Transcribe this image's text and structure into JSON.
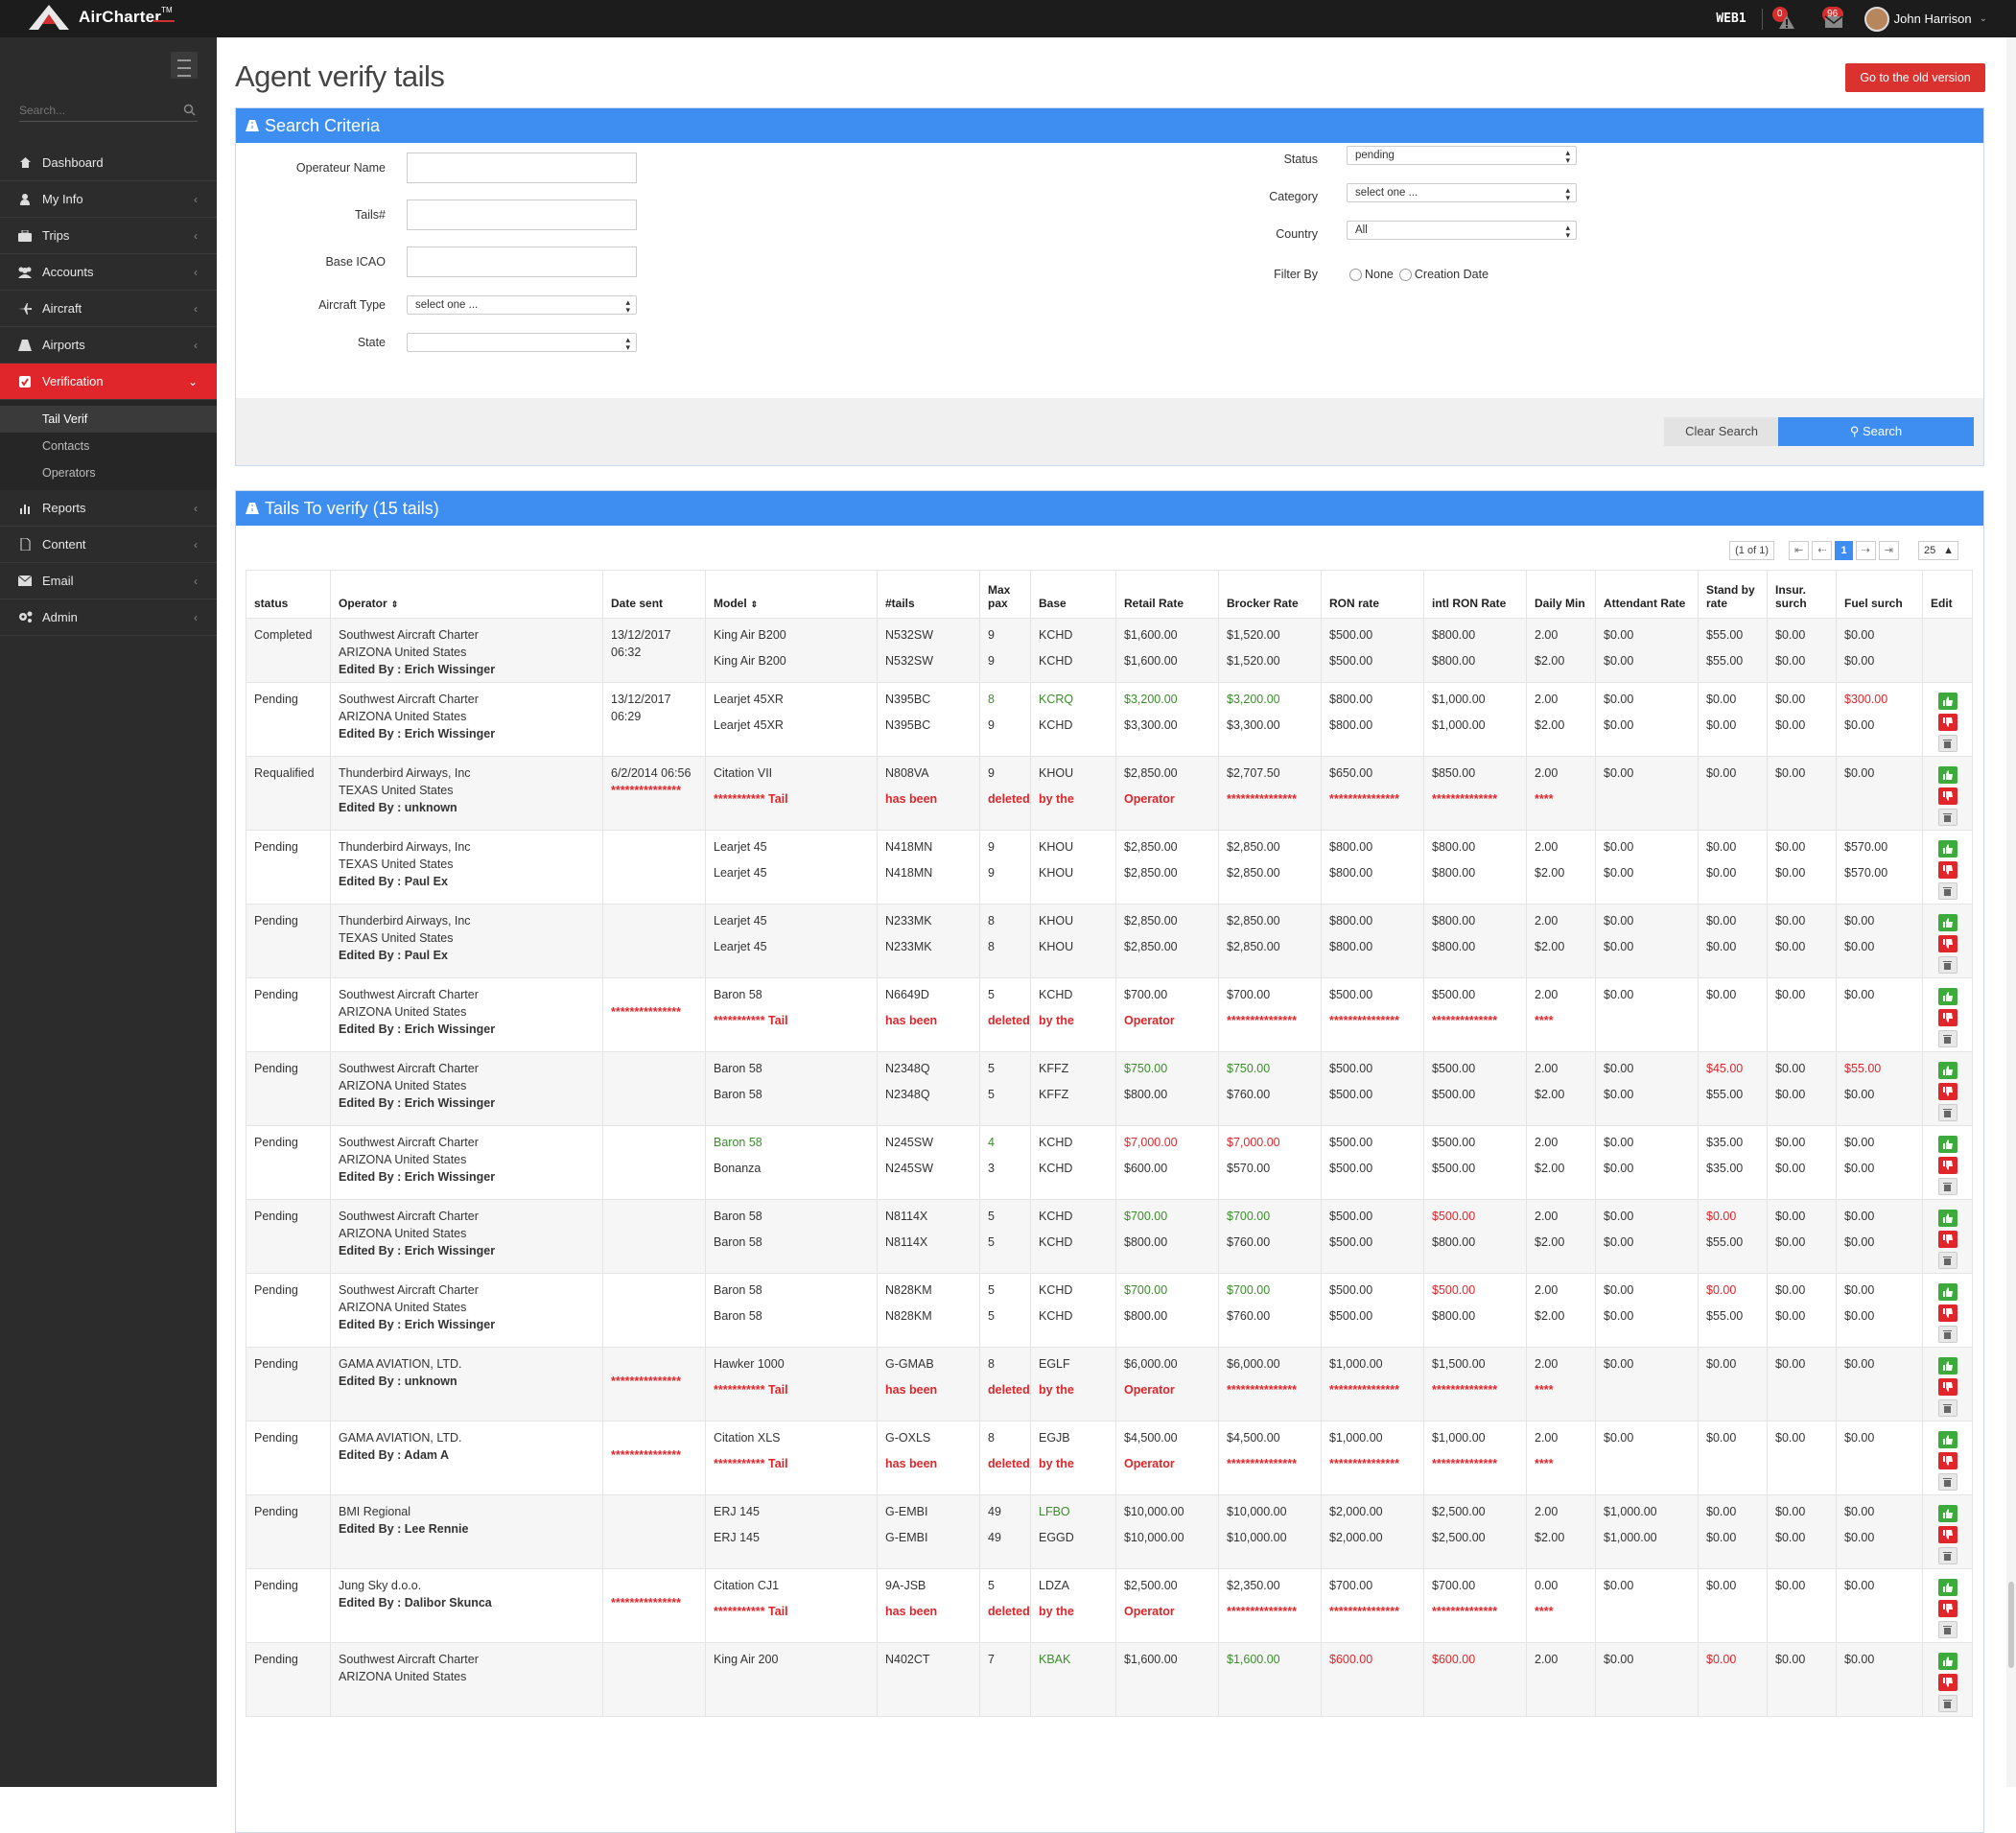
{
  "topbar": {
    "logo_text": "AirCharter",
    "logo_tm": "TM",
    "server": "WEB1",
    "alerts_count": "0",
    "messages_count": "96",
    "user_name": "John Harrison"
  },
  "sidebar": {
    "search_placeholder": "Search...",
    "items": [
      {
        "label": "Dashboard",
        "icon": "home-icon"
      },
      {
        "label": "My Info",
        "icon": "user-icon"
      },
      {
        "label": "Trips",
        "icon": "suitcase-icon"
      },
      {
        "label": "Accounts",
        "icon": "users-icon"
      },
      {
        "label": "Aircraft",
        "icon": "plane-icon"
      },
      {
        "label": "Airports",
        "icon": "road-icon"
      },
      {
        "label": "Verification",
        "icon": "check-square-icon"
      },
      {
        "label": "Reports",
        "icon": "bar-chart-icon"
      },
      {
        "label": "Content",
        "icon": "file-icon"
      },
      {
        "label": "Email",
        "icon": "envelope-icon"
      },
      {
        "label": "Admin",
        "icon": "cogs-icon"
      }
    ],
    "subitems": [
      "Tail Verif",
      "Contacts",
      "Operators"
    ]
  },
  "page": {
    "title": "Agent verify tails",
    "old_version_button": "Go to the old version"
  },
  "criteria": {
    "header": "Search Criteria",
    "operator_label": "Operateur Name",
    "tails_label": "Tails#",
    "base_label": "Base ICAO",
    "aircraft_type_label": "Aircraft Type",
    "aircraft_type_value": "select one ...",
    "state_label": "State",
    "state_value": "",
    "status_label": "Status",
    "status_value": "pending",
    "category_label": "Category",
    "category_value": "select one ...",
    "country_label": "Country",
    "country_value": "All",
    "filter_label": "Filter By",
    "filter_none": "None",
    "filter_creation": "Creation Date",
    "clear_button": "Clear Search",
    "search_button": "Search"
  },
  "tails": {
    "header": "Tails To verify (15 tails)",
    "pager_info": "(1 of 1)",
    "pager_first": "⇤",
    "pager_prev": "⇠",
    "pager_page": "1",
    "pager_next": "⇢",
    "pager_last": "⇥",
    "page_size": "25",
    "columns": [
      "status",
      "Operator",
      "Date sent",
      "Model",
      "#tails",
      "Max pax",
      "Base",
      "Retail Rate",
      "Brocker Rate",
      "RON rate",
      "intl RON Rate",
      "Daily Min",
      "Attendant Rate",
      "Stand by rate",
      "Insur. surch",
      "Fuel surch",
      "Edit"
    ],
    "deleted_tokens": [
      "***************",
      "*********** Tail",
      "has been",
      "deleted",
      "by the",
      "Operator",
      "***************",
      "***************",
      "**************",
      "****"
    ],
    "rows": [
      {
        "status": "Completed",
        "op": [
          "Southwest Aircraft Charter",
          "ARIZONA United States",
          "Edited By : Erich Wissinger"
        ],
        "date": "13/12/2017 06:32",
        "a": [
          "King Air B200",
          "N532SW",
          "9",
          "KCHD",
          "$1,600.00",
          "$1,520.00",
          "$500.00",
          "$800.00",
          "2.00",
          "$0.00",
          "$55.00",
          "$0.00",
          "$0.00"
        ],
        "b": [
          "King Air B200",
          "N532SW",
          "9",
          "KCHD",
          "$1,600.00",
          "$1,520.00",
          "$500.00",
          "$800.00",
          "$2.00",
          "$0.00",
          "$55.00",
          "$0.00",
          "$0.00"
        ],
        "edit": false
      },
      {
        "status": "Pending",
        "op": [
          "Southwest Aircraft Charter",
          "ARIZONA United States",
          "Edited By : Erich Wissinger"
        ],
        "date": "13/12/2017 06:29",
        "a": [
          "Learjet 45XR",
          "N395BC",
          "8",
          "KCRQ",
          "$3,200.00",
          "$3,200.00",
          "$800.00",
          "$1,000.00",
          "2.00",
          "$0.00",
          "$0.00",
          "$0.00",
          "$300.00"
        ],
        "b": [
          "Learjet 45XR",
          "N395BC",
          "9",
          "KCHD",
          "$3,300.00",
          "$3,300.00",
          "$800.00",
          "$1,000.00",
          "$2.00",
          "$0.00",
          "$0.00",
          "$0.00",
          "$0.00"
        ],
        "edit": true
      },
      {
        "status": "Requalified",
        "op": [
          "Thunderbird Airways, Inc",
          "TEXAS United States",
          "Edited By : unknown"
        ],
        "date": "6/2/2014 06:56",
        "a": [
          "Citation VII",
          "N808VA",
          "9",
          "KHOU",
          "$2,850.00",
          "$2,707.50",
          "$650.00",
          "$850.00",
          "2.00",
          "$0.00",
          "$0.00",
          "$0.00",
          "$0.00"
        ],
        "b": null,
        "edit": true
      },
      {
        "status": "Pending",
        "op": [
          "Thunderbird Airways, Inc",
          "TEXAS United States",
          "Edited By : Paul Ex"
        ],
        "date": "",
        "a": [
          "Learjet 45",
          "N418MN",
          "9",
          "KHOU",
          "$2,850.00",
          "$2,850.00",
          "$800.00",
          "$800.00",
          "2.00",
          "$0.00",
          "$0.00",
          "$0.00",
          "$570.00"
        ],
        "b": [
          "Learjet 45",
          "N418MN",
          "9",
          "KHOU",
          "$2,850.00",
          "$2,850.00",
          "$800.00",
          "$800.00",
          "$2.00",
          "$0.00",
          "$0.00",
          "$0.00",
          "$570.00"
        ],
        "edit": true
      },
      {
        "status": "Pending",
        "op": [
          "Thunderbird Airways, Inc",
          "TEXAS United States",
          "Edited By : Paul Ex"
        ],
        "date": "",
        "a": [
          "Learjet 45",
          "N233MK",
          "8",
          "KHOU",
          "$2,850.00",
          "$2,850.00",
          "$800.00",
          "$800.00",
          "2.00",
          "$0.00",
          "$0.00",
          "$0.00",
          "$0.00"
        ],
        "b": [
          "Learjet 45",
          "N233MK",
          "8",
          "KHOU",
          "$2,850.00",
          "$2,850.00",
          "$800.00",
          "$800.00",
          "$2.00",
          "$0.00",
          "$0.00",
          "$0.00",
          "$0.00"
        ],
        "edit": true
      },
      {
        "status": "Pending",
        "op": [
          "Southwest Aircraft Charter",
          "ARIZONA United States",
          "Edited By : Erich Wissinger"
        ],
        "date": "",
        "a": [
          "Baron 58",
          "N6649D",
          "5",
          "KCHD",
          "$700.00",
          "$700.00",
          "$500.00",
          "$500.00",
          "2.00",
          "$0.00",
          "$0.00",
          "$0.00",
          "$0.00"
        ],
        "b": null,
        "edit": true
      },
      {
        "status": "Pending",
        "op": [
          "Southwest Aircraft Charter",
          "ARIZONA United States",
          "Edited By : Erich Wissinger"
        ],
        "date": "",
        "a": [
          "Baron 58",
          "N2348Q",
          "5",
          "KFFZ",
          "$750.00",
          "$750.00",
          "$500.00",
          "$500.00",
          "2.00",
          "$0.00",
          "$45.00",
          "$0.00",
          "$55.00"
        ],
        "b": [
          "Baron 58",
          "N2348Q",
          "5",
          "KFFZ",
          "$800.00",
          "$760.00",
          "$500.00",
          "$500.00",
          "$2.00",
          "$0.00",
          "$55.00",
          "$0.00",
          "$0.00"
        ],
        "edit": true
      },
      {
        "status": "Pending",
        "op": [
          "Southwest Aircraft Charter",
          "ARIZONA United States",
          "Edited By : Erich Wissinger"
        ],
        "date": "",
        "a": [
          "Baron 58",
          "N245SW",
          "4",
          "KCHD",
          "$7,000.00",
          "$7,000.00",
          "$500.00",
          "$500.00",
          "2.00",
          "$0.00",
          "$35.00",
          "$0.00",
          "$0.00"
        ],
        "b": [
          "Bonanza",
          "N245SW",
          "3",
          "KCHD",
          "$600.00",
          "$570.00",
          "$500.00",
          "$500.00",
          "$2.00",
          "$0.00",
          "$35.00",
          "$0.00",
          "$0.00"
        ],
        "edit": true
      },
      {
        "status": "Pending",
        "op": [
          "Southwest Aircraft Charter",
          "ARIZONA United States",
          "Edited By : Erich Wissinger"
        ],
        "date": "",
        "a": [
          "Baron 58",
          "N8114X",
          "5",
          "KCHD",
          "$700.00",
          "$700.00",
          "$500.00",
          "$500.00",
          "2.00",
          "$0.00",
          "$0.00",
          "$0.00",
          "$0.00"
        ],
        "b": [
          "Baron 58",
          "N8114X",
          "5",
          "KCHD",
          "$800.00",
          "$760.00",
          "$500.00",
          "$800.00",
          "$2.00",
          "$0.00",
          "$55.00",
          "$0.00",
          "$0.00"
        ],
        "edit": true
      },
      {
        "status": "Pending",
        "op": [
          "Southwest Aircraft Charter",
          "ARIZONA United States",
          "Edited By : Erich Wissinger"
        ],
        "date": "",
        "a": [
          "Baron 58",
          "N828KM",
          "5",
          "KCHD",
          "$700.00",
          "$700.00",
          "$500.00",
          "$500.00",
          "2.00",
          "$0.00",
          "$0.00",
          "$0.00",
          "$0.00"
        ],
        "b": [
          "Baron 58",
          "N828KM",
          "5",
          "KCHD",
          "$800.00",
          "$760.00",
          "$500.00",
          "$800.00",
          "$2.00",
          "$0.00",
          "$55.00",
          "$0.00",
          "$0.00"
        ],
        "edit": true
      },
      {
        "status": "Pending",
        "op": [
          "GAMA AVIATION, LTD.",
          "Edited By : unknown"
        ],
        "date": "",
        "a": [
          "Hawker 1000",
          "G-GMAB",
          "8",
          "EGLF",
          "$6,000.00",
          "$6,000.00",
          "$1,000.00",
          "$1,500.00",
          "2.00",
          "$0.00",
          "$0.00",
          "$0.00",
          "$0.00"
        ],
        "b": null,
        "edit": true
      },
      {
        "status": "Pending",
        "op": [
          "GAMA AVIATION, LTD.",
          "Edited By : Adam A"
        ],
        "date": "",
        "a": [
          "Citation XLS",
          "G-OXLS",
          "8",
          "EGJB",
          "$4,500.00",
          "$4,500.00",
          "$1,000.00",
          "$1,000.00",
          "2.00",
          "$0.00",
          "$0.00",
          "$0.00",
          "$0.00"
        ],
        "b": null,
        "edit": true
      },
      {
        "status": "Pending",
        "op": [
          "BMI Regional",
          "Edited By : Lee Rennie"
        ],
        "date": "",
        "a": [
          "ERJ 145",
          "G-EMBI",
          "49",
          "LFBO",
          "$10,000.00",
          "$10,000.00",
          "$2,000.00",
          "$2,500.00",
          "2.00",
          "$1,000.00",
          "$0.00",
          "$0.00",
          "$0.00"
        ],
        "b": [
          "ERJ 145",
          "G-EMBI",
          "49",
          "EGGD",
          "$10,000.00",
          "$10,000.00",
          "$2,000.00",
          "$2,500.00",
          "$2.00",
          "$1,000.00",
          "$0.00",
          "$0.00",
          "$0.00"
        ],
        "edit": true
      },
      {
        "status": "Pending",
        "op": [
          "Jung Sky d.o.o.",
          "Edited By : Dalibor Skunca"
        ],
        "date": "",
        "a": [
          "Citation CJ1",
          "9A-JSB",
          "5",
          "LDZA",
          "$2,500.00",
          "$2,350.00",
          "$700.00",
          "$700.00",
          "0.00",
          "$0.00",
          "$0.00",
          "$0.00",
          "$0.00"
        ],
        "b": null,
        "edit": true
      },
      {
        "status": "Pending",
        "op": [
          "Southwest Aircraft Charter",
          "ARIZONA United States"
        ],
        "date": "",
        "a": [
          "King Air 200",
          "N402CT",
          "7",
          "KBAK",
          "$1,600.00",
          "$1,600.00",
          "$600.00",
          "$600.00",
          "2.00",
          "$0.00",
          "$0.00",
          "$0.00",
          "$0.00"
        ],
        "b": null,
        "edit": true
      }
    ],
    "highlights": {
      "1": {
        "a": {
          "2": "g",
          "3": "g",
          "4": "g",
          "5": "g",
          "12": "r"
        }
      },
      "6": {
        "a": {
          "4": "g",
          "5": "g",
          "10": "r",
          "12": "r"
        }
      },
      "7": {
        "a": {
          "0": "g",
          "2": "g",
          "4": "r",
          "5": "r"
        }
      },
      "8": {
        "a": {
          "4": "g",
          "5": "g",
          "7": "r",
          "10": "r"
        }
      },
      "9": {
        "a": {
          "4": "g",
          "5": "g",
          "7": "r",
          "10": "r"
        }
      },
      "12": {
        "a": {
          "3": "g"
        }
      },
      "14": {
        "a": {
          "3": "g",
          "5": "g",
          "6": "r",
          "7": "r",
          "10": "r"
        }
      }
    },
    "deleted_rows": [
      2,
      5,
      10,
      11,
      13
    ]
  }
}
